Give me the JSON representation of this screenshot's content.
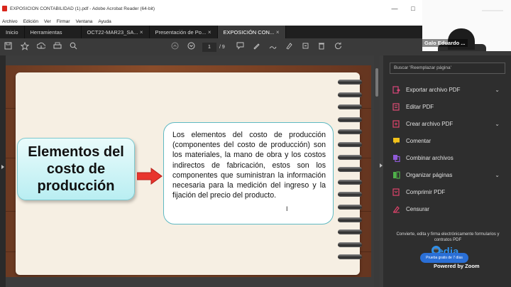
{
  "window": {
    "title": "EXPOSICIÓN CONTABILIDAD (1).pdf - Adobe Acrobat Reader (64-bit)",
    "controls": {
      "minimize": "—",
      "maximize": "□"
    }
  },
  "menu": [
    "Archivo",
    "Edición",
    "Ver",
    "Firmar",
    "Ventana",
    "Ayuda"
  ],
  "tabs": [
    {
      "label": "Inicio"
    },
    {
      "label": "Herramientas"
    },
    {
      "label": "OCT22-MAR23_SA...",
      "close": "×"
    },
    {
      "label": "Presentación de Po...",
      "close": "×"
    },
    {
      "label": "EXPOSICIÓN CON...",
      "close": "×",
      "active": true
    }
  ],
  "toolbar": {
    "page_current": "1",
    "page_total": "/ 9"
  },
  "right_panel": {
    "search_placeholder": "Buscar 'Reemplazar página'",
    "tools": [
      {
        "label": "Exportar archivo PDF",
        "icon": "export-pdf-icon",
        "color": "#d9467a",
        "expandable": true
      },
      {
        "label": "Editar PDF",
        "icon": "edit-pdf-icon",
        "color": "#e04d76",
        "expandable": false
      },
      {
        "label": "Crear archivo PDF",
        "icon": "create-pdf-icon",
        "color": "#e0436b",
        "expandable": true
      },
      {
        "label": "Comentar",
        "icon": "comment-icon",
        "color": "#f2c21b",
        "expandable": false
      },
      {
        "label": "Combinar archivos",
        "icon": "combine-files-icon",
        "color": "#8f5bd8",
        "expandable": false
      },
      {
        "label": "Organizar páginas",
        "icon": "organize-pages-icon",
        "color": "#4fb24a",
        "expandable": true
      },
      {
        "label": "Comprimir PDF",
        "icon": "compress-pdf-icon",
        "color": "#e0436b",
        "expandable": false
      },
      {
        "label": "Censurar",
        "icon": "redact-icon",
        "color": "#e0436b",
        "expandable": false
      }
    ],
    "promo": "Convierte, edita y firma electrónicamente formularios y contratos PDF"
  },
  "zoom_overlay": {
    "participant_name": "Galo Eduardo ...",
    "brand": "cedia",
    "trial_button": "Prueba gratis de 7 días",
    "powered_by": "Powered by Zoom"
  },
  "slide": {
    "title": "Elementos del costo de producción",
    "body": "Los elementos del costo de producción (componentes del costo de producción) son los materiales, la mano de obra y los costos indirectos de fabricación, estos son los componentes que suministran la información necesaria para la medición del ingreso y la fijación del precio del producto."
  },
  "colors": {
    "acrobat_red": "#d9261c",
    "title_box_fill": "#b9eef2",
    "arrow": "#e8352d",
    "text_box_border": "#5fb9c2"
  }
}
